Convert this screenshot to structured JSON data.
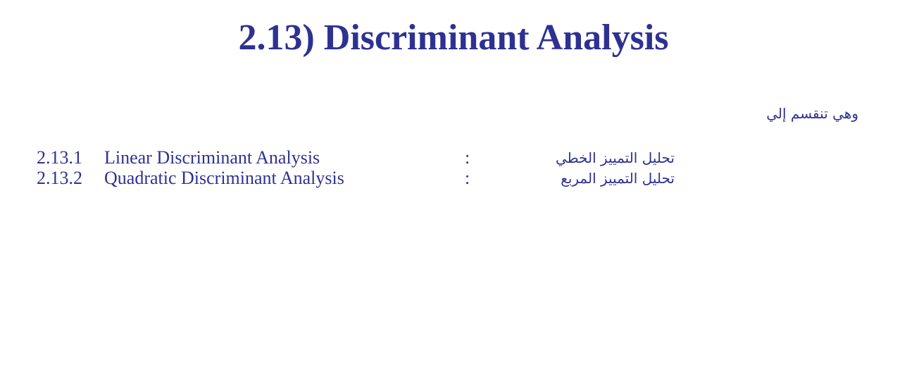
{
  "title": "2.13) Discriminant Analysis",
  "intro": "وهي تنقسم إلي",
  "items": [
    {
      "number": "2.13.1",
      "english": "Linear Discriminant Analysis",
      "separator": ":",
      "arabic": "تحليل التمييز الخطي"
    },
    {
      "number": "2.13.2",
      "english": "Quadratic Discriminant Analysis",
      "separator": ":",
      "arabic": "تحليل التمييز المربع"
    }
  ],
  "colors": {
    "text": "#2e3192",
    "background": "#ffffff"
  }
}
